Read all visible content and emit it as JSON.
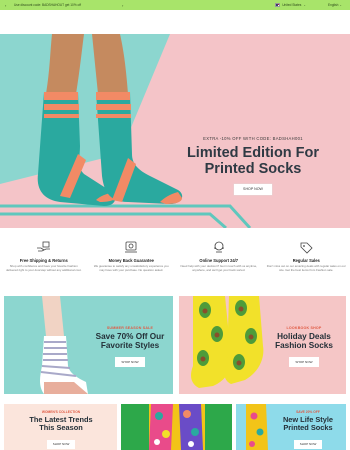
{
  "topbar": {
    "promo": "Use discount code: BADSHAHOUT get 10% off",
    "region": "United States",
    "language": "English"
  },
  "hero": {
    "kicker": "EXTRA -10% OFF WITH CODE: BADSHAH001",
    "title_line1": "Limited Edition For",
    "title_line2": "Printed Socks",
    "button": "SHOP NOW"
  },
  "features": [
    {
      "title": "Free Shipping & Returns",
      "desc": "Shop with confidence and have your favorite Fashion delivered right to your doorstep without any additional cost.",
      "icon": "shipping-hand-icon"
    },
    {
      "title": "Money Back Guarantee",
      "desc": "We guarantee to satisfy any unsatisfactory experience you may have with your purchase. No question asked.",
      "icon": "money-back-icon"
    },
    {
      "title": "Online Support 24/7",
      "desc": "Need help with your decision? Get in touch with us anytime, anywhere, and we'll get your back sorted.",
      "icon": "support-icon"
    },
    {
      "title": "Regular Sales",
      "desc": "Don't miss out on our amazing deals with regular sales on our site. Get the best items from Fashion sale.",
      "icon": "sales-tag-icon"
    }
  ],
  "banners": {
    "summer": {
      "kicker": "SUMMER SEASON SALE",
      "line1": "Save 70% Off Our",
      "line2": "Favorite Styles",
      "button": "SHOP NOW"
    },
    "lookbook": {
      "kicker": "LOOKBOOK SHOP",
      "line1": "Holiday Deals",
      "line2": "Fashion Socks",
      "button": "SHOP NOW"
    },
    "women": {
      "kicker": "WOMEN'S COLLECTION",
      "line1": "The Latest Trends",
      "line2": "This Season",
      "button": "SHOP NOW"
    },
    "lifestyle": {
      "kicker": "SAVE 20% OFF",
      "line1": "New Life Style",
      "line2": "Printed Socks",
      "button": "SHOP NOW"
    }
  },
  "colors": {
    "topbar_bg": "#a8e46a",
    "hero_pink": "#f4c4c8",
    "hero_teal": "#8cd6cf",
    "sock_teal": "#2aa99f",
    "sock_coral": "#f28a65",
    "accent_red": "#e05a43"
  }
}
